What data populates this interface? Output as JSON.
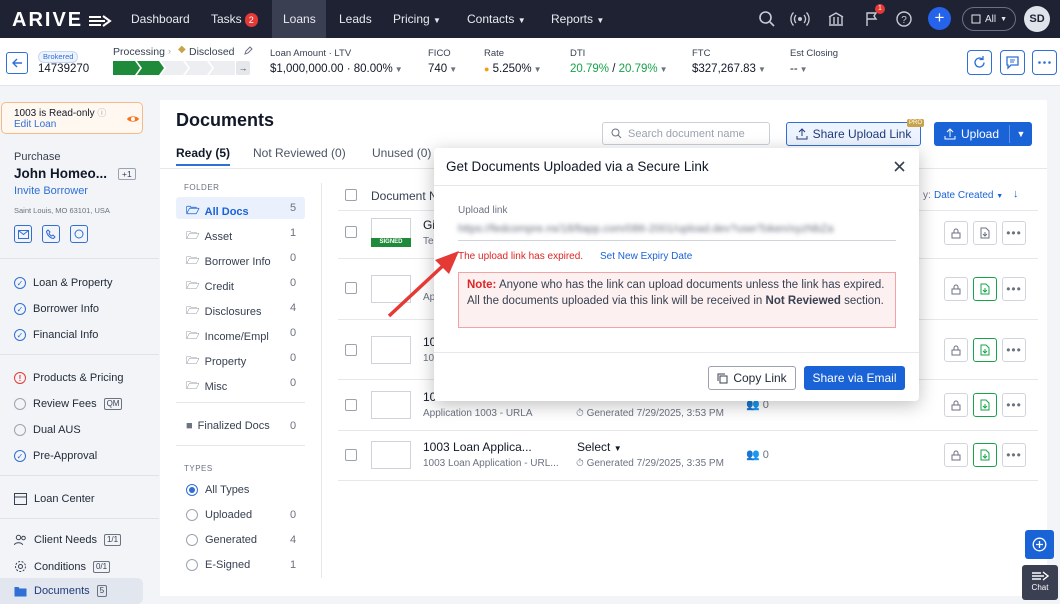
{
  "nav": {
    "logo": "ARIVE",
    "items": [
      "Dashboard",
      "Tasks",
      "Loans",
      "Leads",
      "Pricing",
      "Contacts",
      "Reports"
    ],
    "tasks_badge": "2",
    "notif_badge": "1",
    "all_label": "All",
    "avatar": "SD"
  },
  "loanbar": {
    "brokered": "Brokered",
    "loan_number": "14739270",
    "stage_processing": "Processing",
    "stage_disclosed": "Disclosed",
    "loan_amount_label": "Loan Amount · LTV",
    "loan_amount": "$1,000,000.00 · 80.00%",
    "fico_label": "FICO",
    "fico": "740",
    "rate_label": "Rate",
    "rate": "5.250%",
    "dti_label": "DTI",
    "dti_a": "20.79%",
    "dti_sep": "/",
    "dti_b": "20.79%",
    "ftc_label": "FTC",
    "ftc": "$327,267.83",
    "closing_label": "Est Closing",
    "closing": "--"
  },
  "sidebar": {
    "readonly": "1003 is Read-only",
    "edit_loan": "Edit Loan",
    "loan_type": "Purchase",
    "borrower": "John Homeo...",
    "borrower_extra": "+1",
    "invite": "Invite Borrower",
    "address": "Saint Louis, MO 63101, USA",
    "items": [
      {
        "label": "Loan & Property"
      },
      {
        "label": "Borrower Info"
      },
      {
        "label": "Financial Info"
      },
      {
        "label": "Products & Pricing"
      },
      {
        "label": "Review Fees",
        "tag": "QM"
      },
      {
        "label": "Dual AUS"
      },
      {
        "label": "Pre-Approval"
      },
      {
        "label": "Loan Center"
      },
      {
        "label": "Client Needs",
        "tag": "1/1"
      },
      {
        "label": "Conditions",
        "tag": "0/1"
      },
      {
        "label": "Documents",
        "tag": "5"
      }
    ]
  },
  "main": {
    "title": "Documents",
    "tabs": [
      "Ready (5)",
      "Not Reviewed (0)",
      "Unused (0)"
    ],
    "search_placeholder": "Search document name",
    "share_upload": "Share Upload Link",
    "pro": "PRO",
    "upload": "Upload",
    "folder_header": "FOLDER",
    "folders": [
      {
        "name": "All Docs",
        "count": "5"
      },
      {
        "name": "Asset",
        "count": "1"
      },
      {
        "name": "Borrower Info",
        "count": "0"
      },
      {
        "name": "Credit",
        "count": "0"
      },
      {
        "name": "Disclosures",
        "count": "4"
      },
      {
        "name": "Income/Empl",
        "count": "0"
      },
      {
        "name": "Property",
        "count": "0"
      },
      {
        "name": "Misc",
        "count": "0"
      }
    ],
    "finalized": {
      "name": "Finalized Docs",
      "count": "0"
    },
    "types_header": "TYPES",
    "types": [
      {
        "name": "All Types",
        "count": ""
      },
      {
        "name": "Uploaded",
        "count": "0"
      },
      {
        "name": "Generated",
        "count": "4"
      },
      {
        "name": "E-Signed",
        "count": "1"
      }
    ],
    "col_document": "Document N",
    "sort_label": "y:",
    "sort_value": "Date Created",
    "rows": [
      {
        "name": "Gi",
        "sub": "Te",
        "signed": "SIGNED"
      },
      {
        "name": "",
        "sub": "Apl"
      },
      {
        "name": "10",
        "sub": "10"
      },
      {
        "name": "10",
        "sub": "Application 1003 - URLA",
        "generated": "Generated 7/29/2025, 3:53 PM",
        "users": "0"
      },
      {
        "name": "1003 Loan Applica...",
        "sub": "1003 Loan Application - URL...",
        "select": "Select",
        "generated": "Generated 7/29/2025, 3:35 PM",
        "users": "0"
      }
    ]
  },
  "modal": {
    "title": "Get Documents Uploaded via a Secure Link",
    "upload_link_label": "Upload link",
    "upload_link_value": "https://fedcompre.ns/18/ltapp.com/086-2001/upload.dev?userToken/xyzNbZa",
    "expired": "The upload link has expired.",
    "set_expiry": "Set New Expiry Date",
    "note_label": "Note:",
    "note_text": "Anyone who has the link can upload documents unless the link has expired. All the documents uploaded via this link will be received in",
    "note_bold": "Not Reviewed",
    "note_tail": "section.",
    "copy_link": "Copy Link",
    "share_email": "Share via Email"
  },
  "chat": "Chat"
}
